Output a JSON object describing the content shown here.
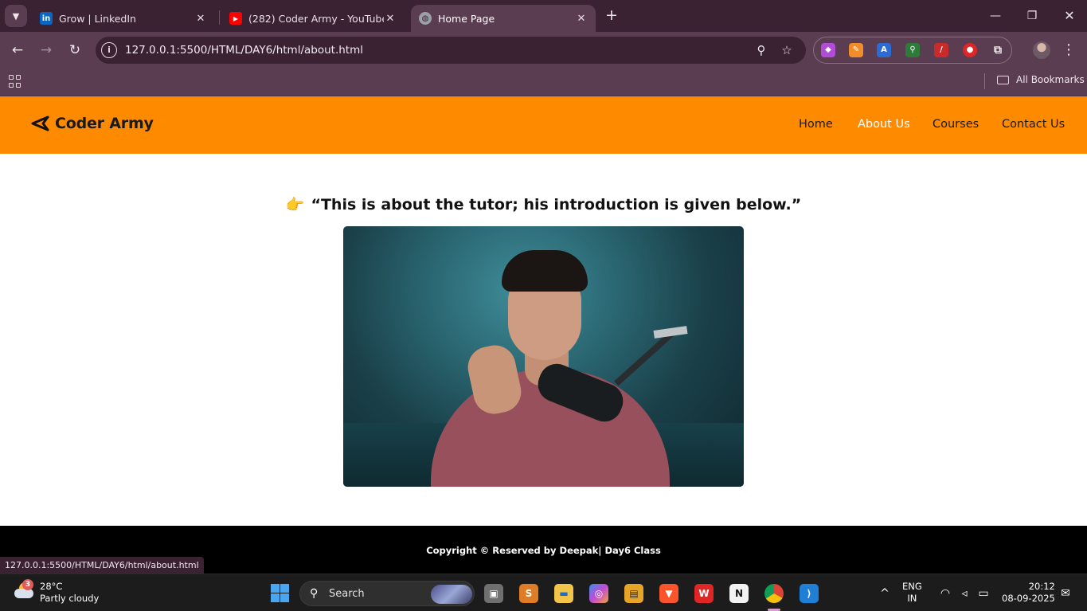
{
  "browser": {
    "tabs": [
      {
        "label": "Grow | LinkedIn",
        "icon": "linkedin-icon",
        "color": "#0a66c2"
      },
      {
        "label": "(282) Coder Army - YouTube",
        "icon": "youtube-icon",
        "color": "#ff0000"
      },
      {
        "label": "Home Page",
        "icon": "globe-icon",
        "color": "#9aa0a6"
      }
    ],
    "url": "127.0.0.1:5500/HTML/DAY6/html/about.html",
    "bookmarks_label": "All Bookmarks",
    "status_url": "127.0.0.1:5500/HTML/DAY6/html/about.html"
  },
  "site": {
    "brand": "Coder Army",
    "nav": [
      {
        "label": "Home",
        "active": false
      },
      {
        "label": "About Us",
        "active": true
      },
      {
        "label": "Courses",
        "active": false
      },
      {
        "label": "Contact Us",
        "active": false
      }
    ],
    "heading": "“This is about the tutor; his introduction is given below.”",
    "heading_icon": "👉",
    "footer": "Copyright © Reserved by Deepak| Day6 Class",
    "colors": {
      "header": "#fe8a00",
      "footer": "#000000",
      "active_nav": "#ffffff"
    }
  },
  "taskbar": {
    "weather_temp": "28°C",
    "weather_desc": "Partly cloudy",
    "weather_badge": "3",
    "search_label": "Search",
    "lang_top": "ENG",
    "lang_bottom": "IN",
    "time": "20:12",
    "date": "08-09-2025"
  }
}
